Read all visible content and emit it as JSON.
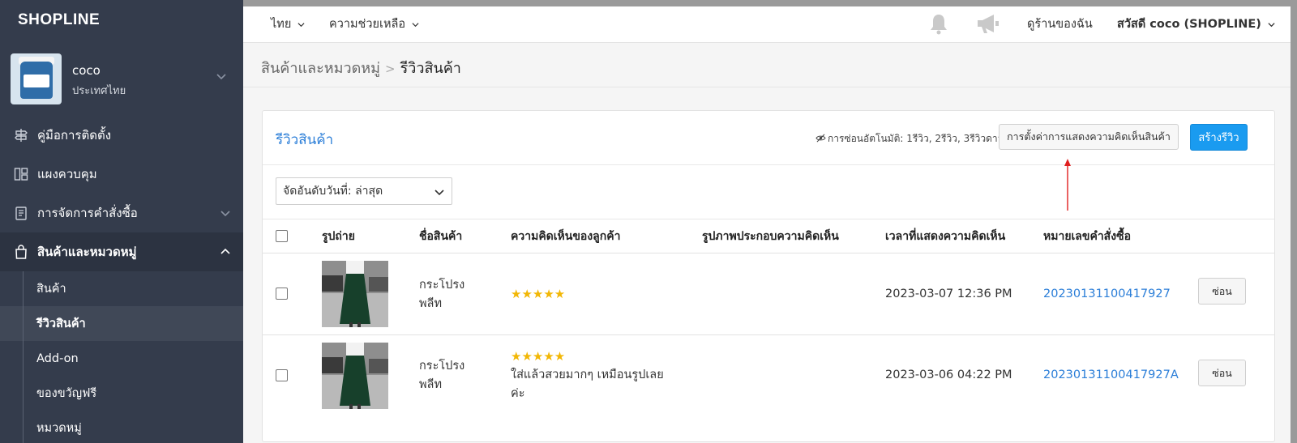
{
  "sidebar": {
    "logo": "SHOPLINE",
    "store_name": "coco",
    "store_country": "ประเทศไทย",
    "items": [
      {
        "label": "คู่มือการติดตั้ง",
        "icon": "signpost-icon"
      },
      {
        "label": "แผงควบคุม",
        "icon": "dashboard-icon"
      },
      {
        "label": "การจัดการคำสั่งซื้อ",
        "icon": "clipboard-icon"
      },
      {
        "label": "สินค้าและหมวดหมู่",
        "icon": "bag-icon"
      }
    ],
    "subitems": [
      {
        "label": "สินค้า"
      },
      {
        "label": "รีวิวสินค้า"
      },
      {
        "label": "Add-on"
      },
      {
        "label": "ของขวัญฟรี"
      },
      {
        "label": "หมวดหมู่"
      }
    ]
  },
  "topbar": {
    "language": "ไทย",
    "help": "ความช่วยเหลือ",
    "view_store": "ดูร้านของฉัน",
    "greeting": "สวัสดี coco (SHOPLINE)"
  },
  "breadcrumb": {
    "parent": "สินค้าและหมวดหมู่",
    "current": "รีวิวสินค้า"
  },
  "panel": {
    "title": "รีวิวสินค้า",
    "auto_hide": "การซ่อนอัตโนมัติ: 1รีวิว, 2รีวิว, 3รีวิวดาว",
    "settings_button": "การตั้งค่าการแสดงความคิดเห็นสินค้า",
    "create_button": "สร้างรีวิว",
    "sort_label": "จัดอันดับวันที่: ล่าสุด"
  },
  "table": {
    "headers": [
      "รูปถ่าย",
      "ชื่อสินค้า",
      "ความคิดเห็นของลูกค้า",
      "รูปภาพประกอบความคิดเห็น",
      "เวลาที่แสดงความคิดเห็น",
      "หมายเลขคำสั่งซื้อ"
    ],
    "rows": [
      {
        "product_line1": "กระโปรง",
        "product_line2": "พลีท",
        "stars": "★★★★★",
        "comment_line1": "",
        "comment_line2": "",
        "time": "2023-03-07 12:36 PM",
        "order": "20230131100417927",
        "action": "ซ่อน"
      },
      {
        "product_line1": "กระโปรง",
        "product_line2": "พลีท",
        "stars": "★★★★★",
        "comment_line1": "ใส่แล้วสวยมากๆ เหมือนรูปเลย",
        "comment_line2": "ค่ะ",
        "time": "2023-03-06 04:22 PM",
        "order": "20230131100417927A",
        "action": "ซ่อน"
      }
    ]
  },
  "colors": {
    "sidebar_bg": "#343c4c",
    "accent": "#2b7ed8",
    "primary_button": "#1a9bf0",
    "stars": "#f2b705",
    "annotation_arrow": "#e02020"
  }
}
